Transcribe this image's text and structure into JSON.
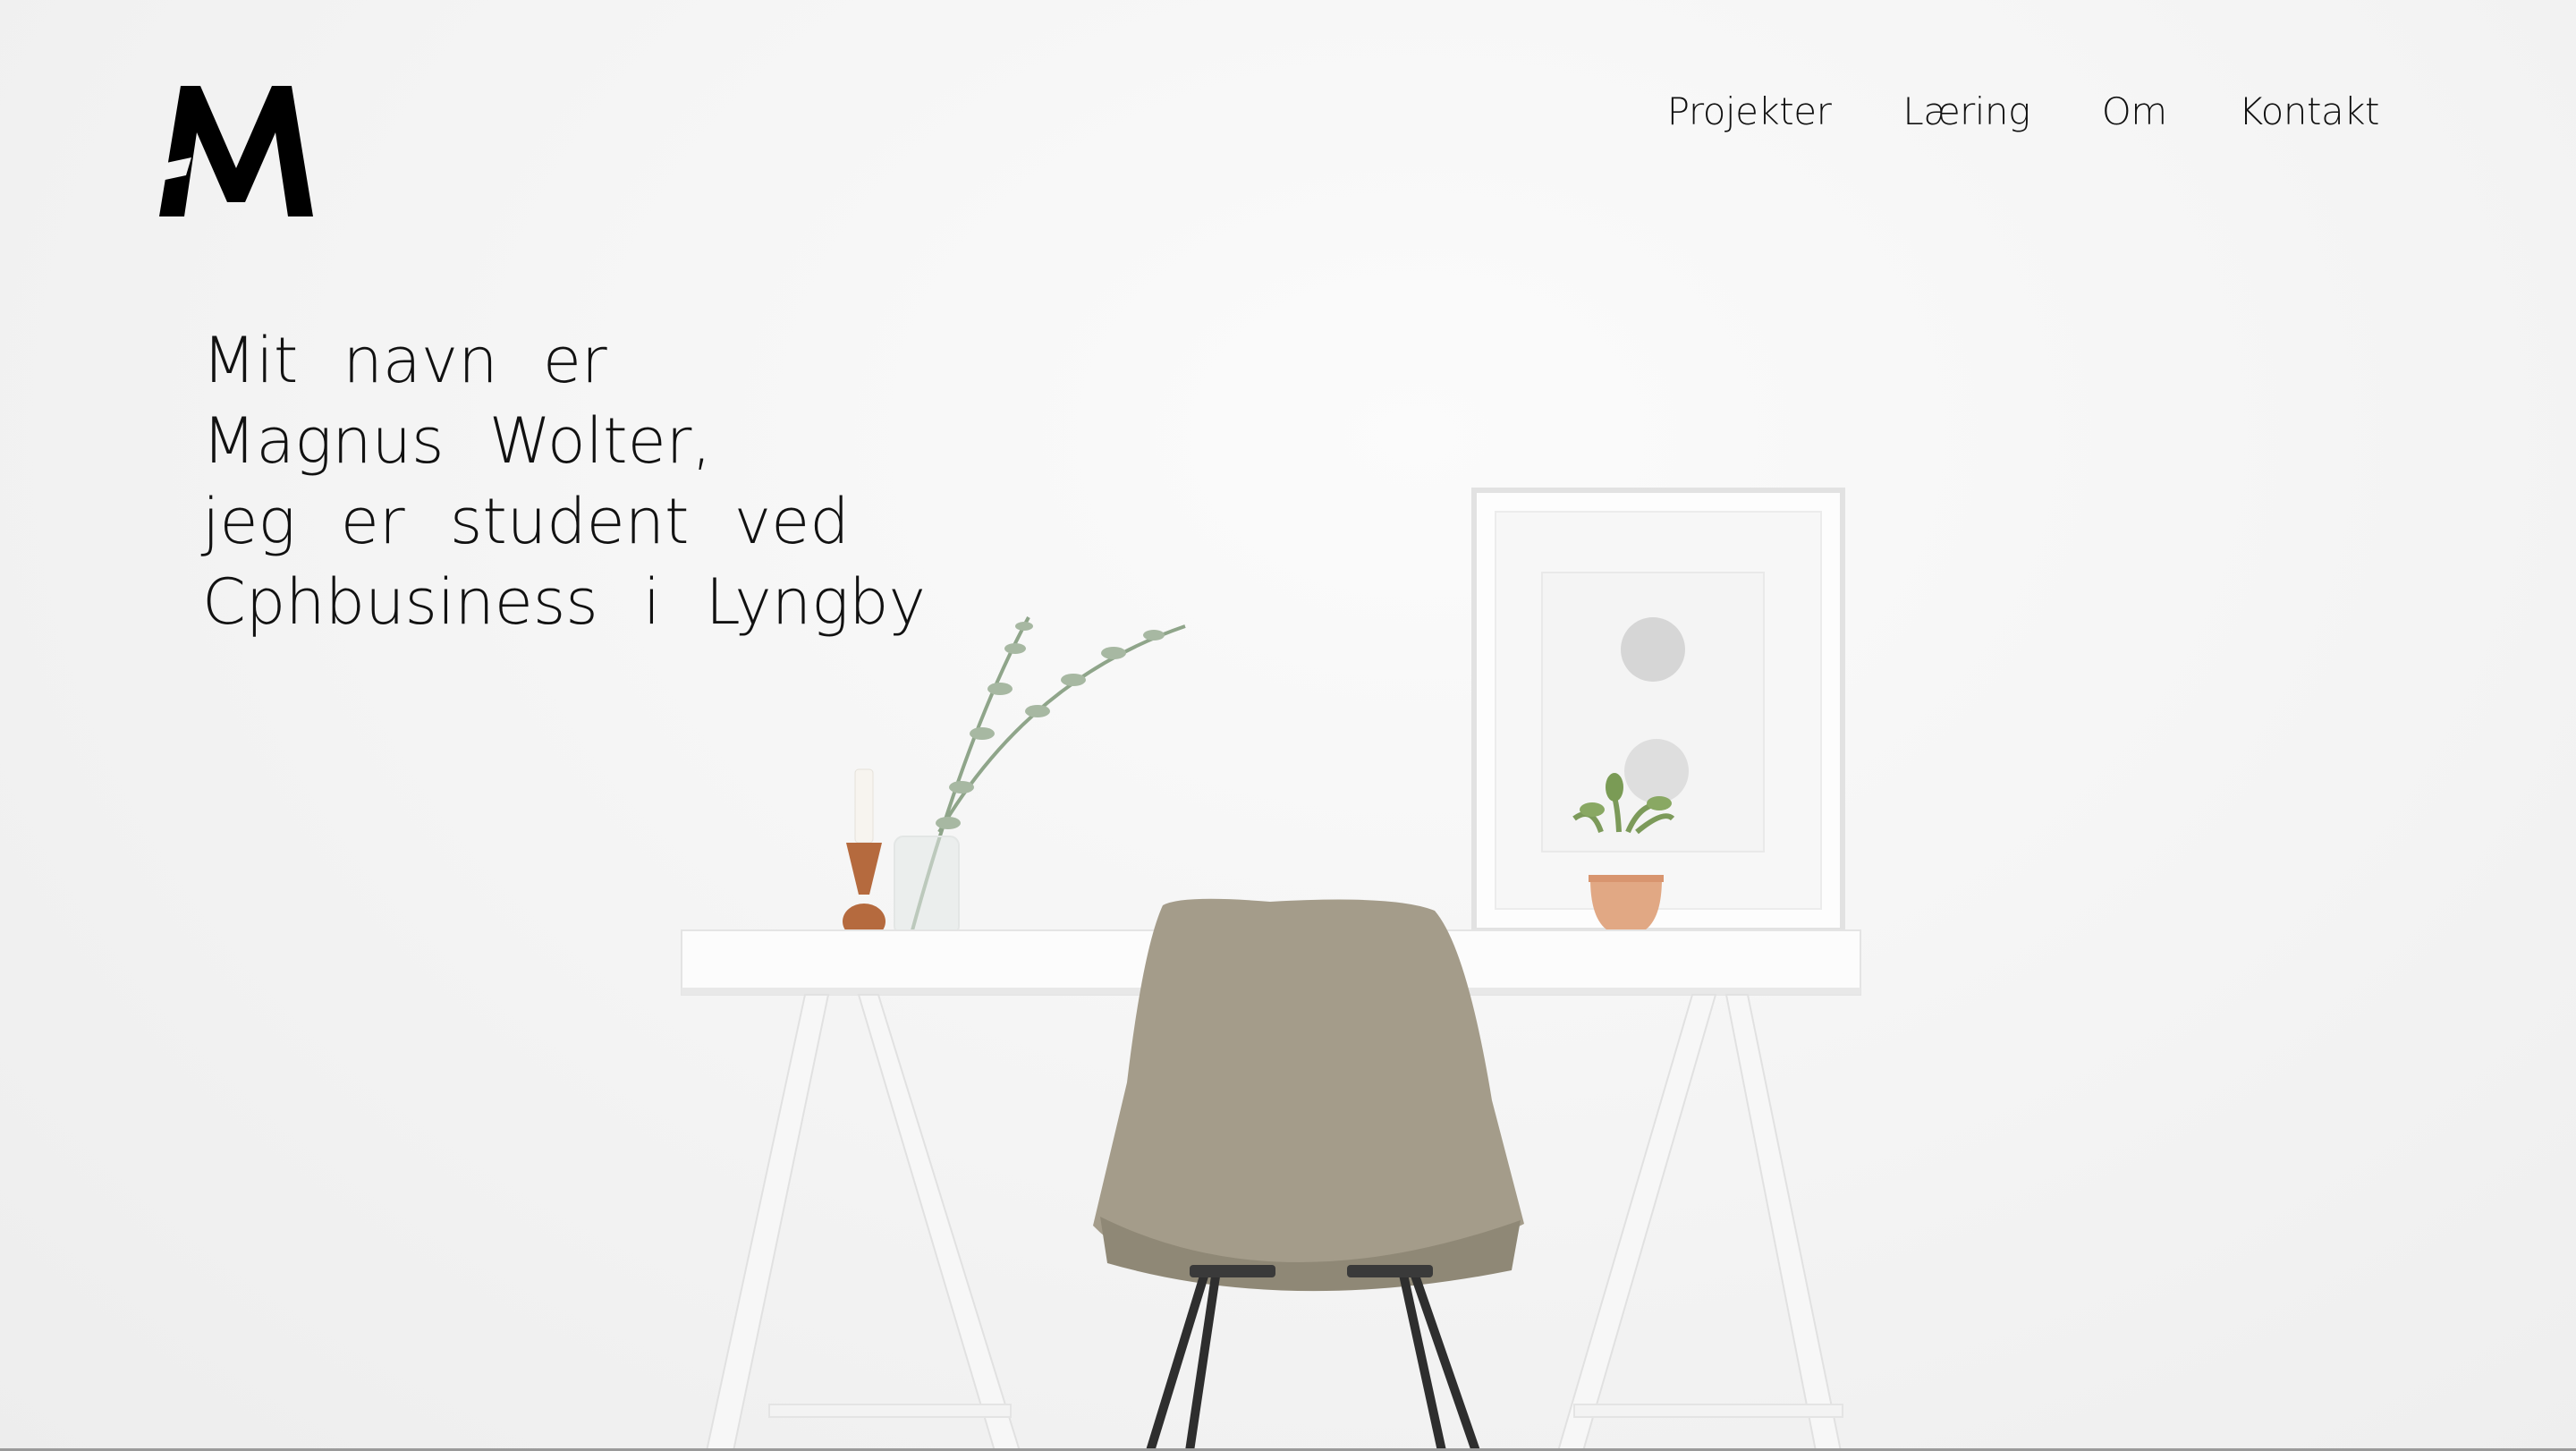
{
  "logo": {
    "letter": "M",
    "alt": "M logo"
  },
  "nav": {
    "items": [
      {
        "label": "Projekter"
      },
      {
        "label": "Læring"
      },
      {
        "label": "Om"
      },
      {
        "label": "Kontakt"
      }
    ]
  },
  "intro": {
    "lines": [
      "Mit navn er",
      "Magnus Wolter,",
      "jeg er student ved",
      "Cphbusiness i Lyngby"
    ]
  },
  "colors": {
    "text": "#111111",
    "background": "#f3f3f3",
    "chair": "#a49c8a",
    "vase": "#b56a3e",
    "pot": "#e1a884"
  }
}
